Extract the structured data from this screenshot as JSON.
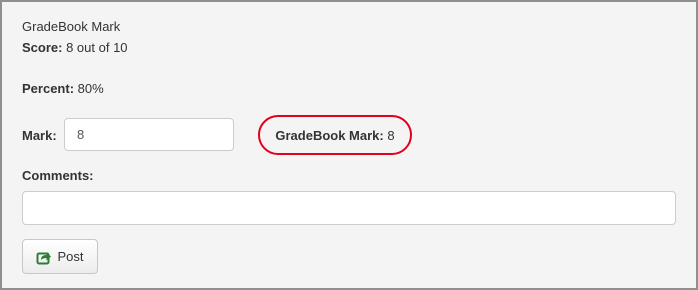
{
  "gradebook": {
    "title": "GradeBook Mark",
    "score_label": "Score:",
    "score_value": "8 out of 10",
    "percent_label": "Percent:",
    "percent_value": "80%",
    "mark_label": "Mark:",
    "mark_value": "8",
    "gradebook_mark_label": "GradeBook Mark:",
    "gradebook_mark_value": "8",
    "comments_label": "Comments:",
    "comments_value": "",
    "post_label": "Post",
    "post_icon": "share-icon",
    "highlight_color": "#e3001b",
    "icon_color": "#2e7d32"
  }
}
